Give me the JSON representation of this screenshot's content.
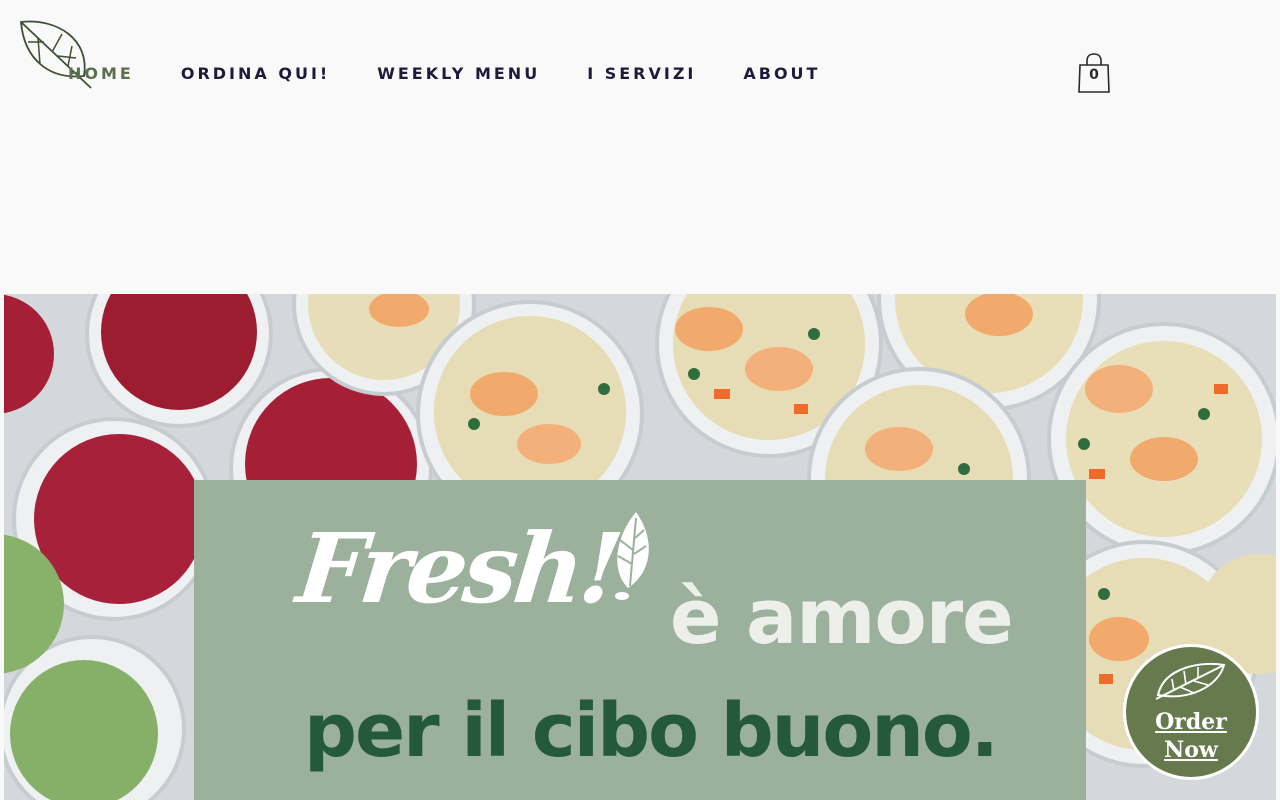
{
  "nav": {
    "items": [
      {
        "label": "HOME",
        "active": true
      },
      {
        "label": "ORDINA QUI!",
        "active": false
      },
      {
        "label": "WEEKLY MENU",
        "active": false
      },
      {
        "label": "I SERVIZI",
        "active": false
      },
      {
        "label": "ABOUT",
        "active": false
      }
    ]
  },
  "cart": {
    "count": "0",
    "icon": "shopping-bag-icon"
  },
  "logo": {
    "icon": "leaf-icon"
  },
  "hero": {
    "brand": "Fresh!",
    "line1": "è amore",
    "line2": "per il cibo buono."
  },
  "order_button": {
    "line1": "Order",
    "line2": "Now",
    "icon": "leaf-icon"
  },
  "colors": {
    "nav_text": "#1e1b3a",
    "nav_active": "#59704a",
    "banner_bg": "#9bb19c",
    "tagline": "#245a3a",
    "order_button_bg": "#667a4e"
  }
}
